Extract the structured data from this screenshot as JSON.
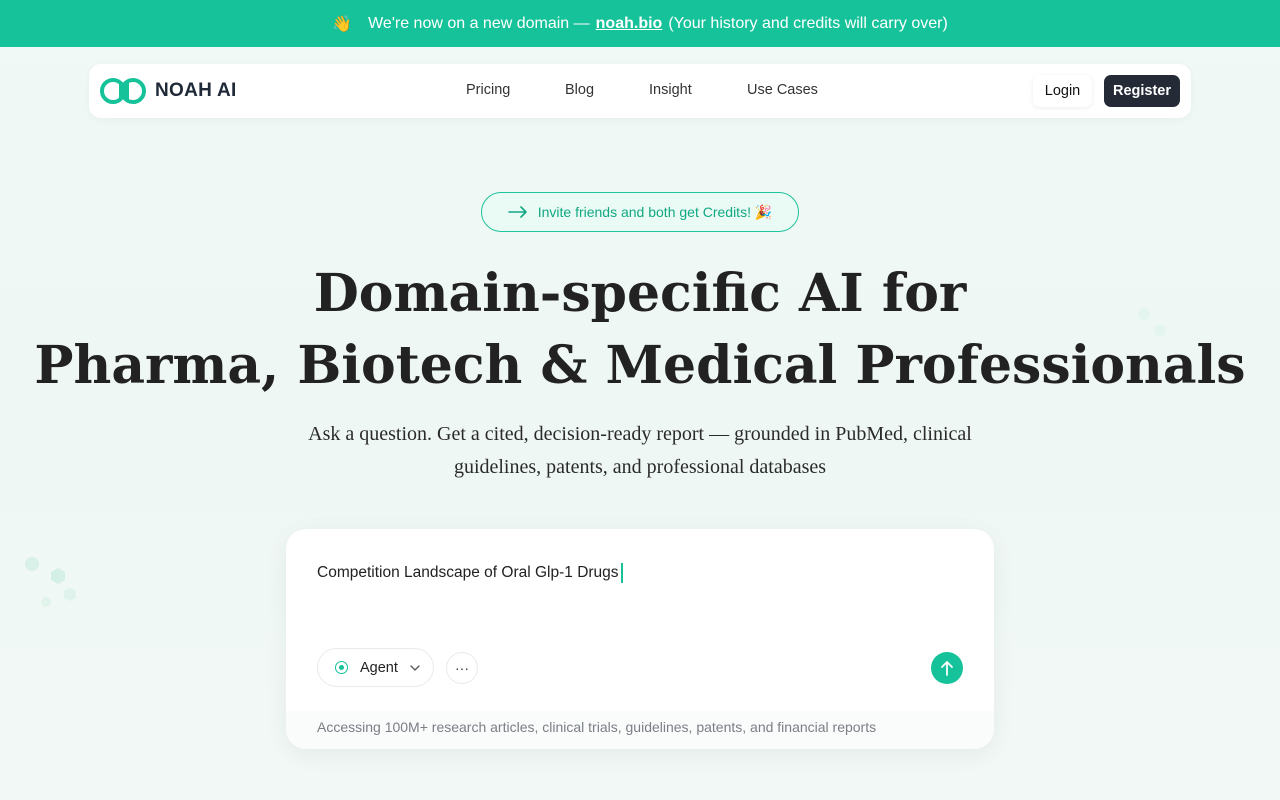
{
  "announcement": {
    "emoji": "👋",
    "text_before": "We're now on a new domain —",
    "link": "noah.bio",
    "text_after": "(Your history and credits will carry over)"
  },
  "navbar": {
    "brand": "NOAH AI",
    "links": [
      "Pricing",
      "Blog",
      "Insight",
      "Use Cases"
    ],
    "login_label": "Login",
    "register_label": "Register"
  },
  "invite": {
    "text": "Invite friends and both get Credits! 🎉"
  },
  "hero": {
    "title_line1": "Domain-specific AI for",
    "title_line2": "Pharma, Biotech & Medical Professionals",
    "subtitle_line1": "Ask a question. Get a cited, decision-ready report — grounded in PubMed, clinical",
    "subtitle_line2": "guidelines, patents, and professional databases"
  },
  "search": {
    "query": "Competition Landscape of Oral Glp-1 Drugs",
    "mode_label": "Agent",
    "more_label": "···",
    "footer_text": "Accessing 100M+ research articles, clinical trials, guidelines, patents, and financial reports"
  },
  "colors": {
    "accent": "#16c29a",
    "dark_button": "#252b36"
  }
}
